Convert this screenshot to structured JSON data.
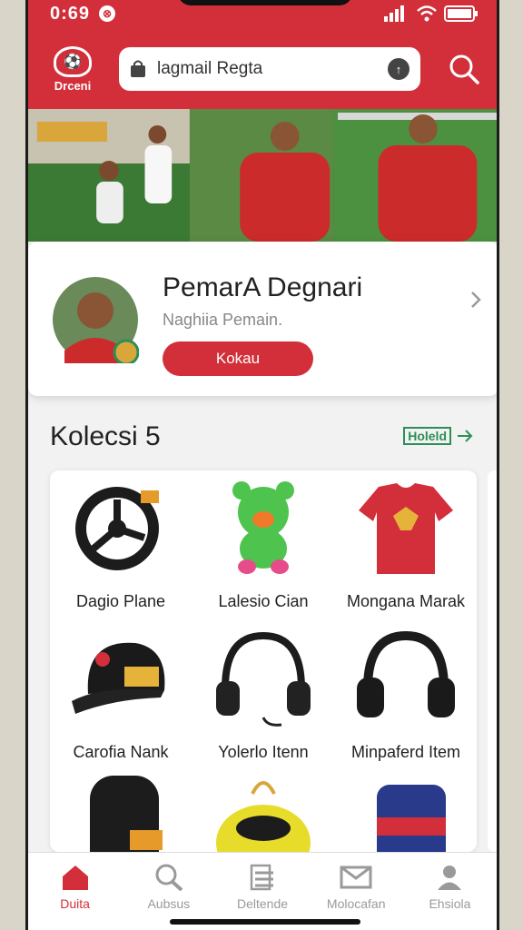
{
  "status": {
    "time": "0:69",
    "badge": "⊗"
  },
  "header": {
    "logo_text": "Drceni",
    "search_value": "lagmail Regta"
  },
  "featured": {
    "title": "PemarA Degnari",
    "subtitle": "Naghiia Pemain.",
    "button_label": "Kokau"
  },
  "collection": {
    "title": "Kolecsi 5",
    "see_all_label": "Holeld",
    "items": [
      {
        "label": "Dagio Plane",
        "icon": "wheel-icon"
      },
      {
        "label": "Lalesio Cian",
        "icon": "mascot-toy-icon"
      },
      {
        "label": "Mongana Marak",
        "icon": "jersey-icon"
      },
      {
        "label": "Carofia Nank",
        "icon": "cap-icon"
      },
      {
        "label": "Yolerlo Itenn",
        "icon": "headphones-icon"
      },
      {
        "label": "Minpaferd Item",
        "icon": "headphones-icon"
      },
      {
        "label": "",
        "icon": "tire-icon"
      },
      {
        "label": "",
        "icon": "bag-icon"
      },
      {
        "label": "",
        "icon": "can-icon"
      }
    ]
  },
  "nav": {
    "items": [
      {
        "label": "Duita",
        "icon": "home-icon",
        "active": true
      },
      {
        "label": "Aubsus",
        "icon": "search-icon",
        "active": false
      },
      {
        "label": "Deltende",
        "icon": "list-icon",
        "active": false
      },
      {
        "label": "Molocafan",
        "icon": "mail-icon",
        "active": false
      },
      {
        "label": "Ehsiola",
        "icon": "profile-icon",
        "active": false
      }
    ]
  },
  "colors": {
    "brand": "#d32f3a",
    "accent_green": "#2b8f57",
    "background": "#f3f2f2"
  }
}
